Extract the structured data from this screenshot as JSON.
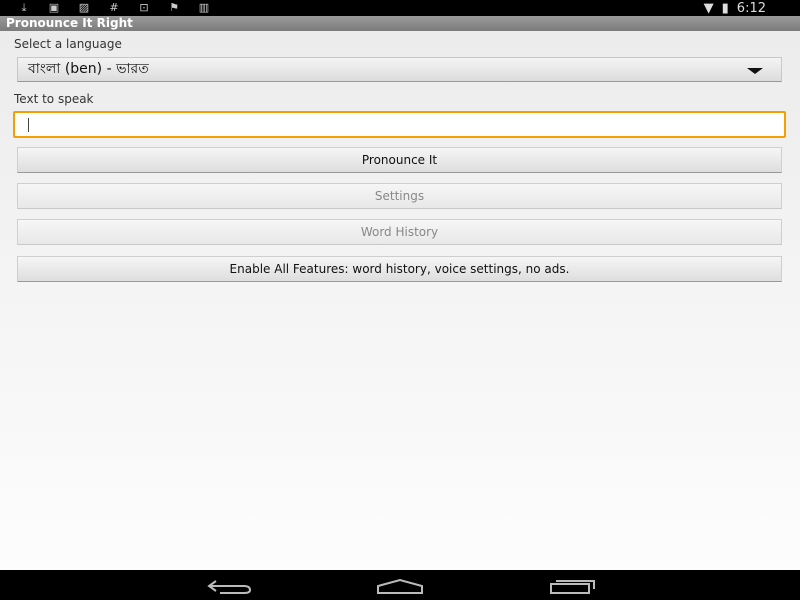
{
  "status_bar": {
    "icons": [
      "download-icon",
      "photo-icon",
      "gallery-icon",
      "hash-icon",
      "save-icon",
      "flag-icon",
      "barcode-icon"
    ],
    "time": "6:12",
    "right_icons": [
      "wifi-icon",
      "battery-charging-icon"
    ]
  },
  "app": {
    "title": "Pronounce It Right"
  },
  "form": {
    "language_label": "Select a language",
    "language_value": "বাংলা (ben) - ভারত",
    "text_label": "Text to speak",
    "text_value": "",
    "text_placeholder": ""
  },
  "buttons": {
    "pronounce": "Pronounce It",
    "settings": "Settings",
    "history": "Word History",
    "enable": "Enable All Features: word history, voice settings, no ads."
  },
  "colors": {
    "accent": "#f5a000"
  }
}
